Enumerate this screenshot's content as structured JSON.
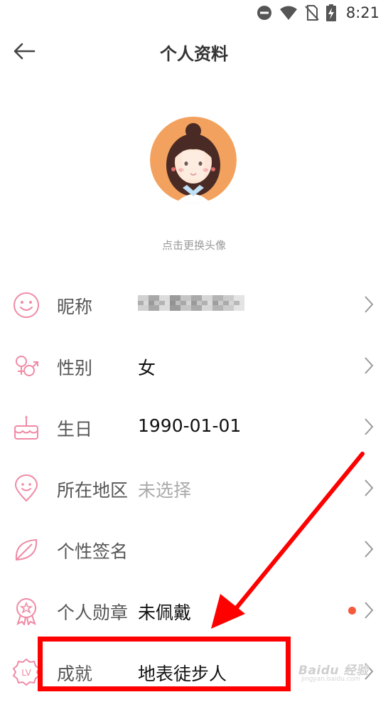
{
  "status_bar": {
    "time": "8:21",
    "icons": [
      "do-not-disturb-icon",
      "wifi-icon",
      "no-sim-icon",
      "battery-charging-icon"
    ]
  },
  "header": {
    "title": "个人资料",
    "back_icon": "back-arrow-icon"
  },
  "avatar": {
    "hint": "点击更换头像"
  },
  "profile_rows": [
    {
      "icon": "smiley-icon",
      "label": "昵称",
      "value": ""
    },
    {
      "icon": "gender-icon",
      "label": "性别",
      "value": "女"
    },
    {
      "icon": "cake-icon",
      "label": "生日",
      "value": "1990-01-01"
    },
    {
      "icon": "location-pin-icon",
      "label": "所在地区",
      "value": "未选择"
    },
    {
      "icon": "leaf-icon",
      "label": "个性签名",
      "value": ""
    },
    {
      "icon": "medal-icon",
      "label": "个人勋章",
      "value": "未佩戴"
    },
    {
      "icon": "level-badge-icon",
      "label": "成就",
      "value": "地表徒步人"
    }
  ],
  "annotation": {
    "color": "#ff0000"
  },
  "theme": {
    "accent": "#f08aa5",
    "muted_text": "#aaaaaa",
    "chevron": "#9a9a9a",
    "dot": "#f55a3c"
  },
  "watermark": {
    "text": "Baidu 经验",
    "sub": "jingyan.baidu.com"
  }
}
